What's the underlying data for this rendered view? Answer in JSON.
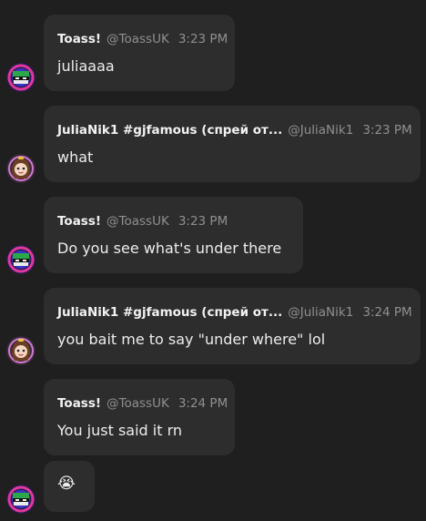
{
  "messages": [
    {
      "name": "Toass!",
      "handle": "@ToassUK",
      "time": "3:23 PM",
      "text": "juliaaaa"
    },
    {
      "name": "JuliaNik1 #gjfamous (спрей от...",
      "handle": "@JuliaNik1",
      "time": "3:23 PM",
      "text": "what"
    },
    {
      "name": "Toass!",
      "handle": "@ToassUK",
      "time": "3:23 PM",
      "text": "Do you see what's under there"
    },
    {
      "name": "JuliaNik1 #gjfamous (спрей от...",
      "handle": "@JuliaNik1",
      "time": "3:24 PM",
      "text": "you bait me to say \"under where\" lol"
    },
    {
      "name": "Toass!",
      "handle": "@ToassUK",
      "time": "3:24 PM",
      "text": "You just said it rn"
    },
    {
      "emoji": "😭"
    }
  ],
  "avatars": {
    "toass": "toass-avatar",
    "julia": "julia-avatar"
  },
  "colors": {
    "background": "#1f1f1f",
    "bubble": "#2d2d2d",
    "muted": "#8f8f8f",
    "text": "#ededed"
  }
}
